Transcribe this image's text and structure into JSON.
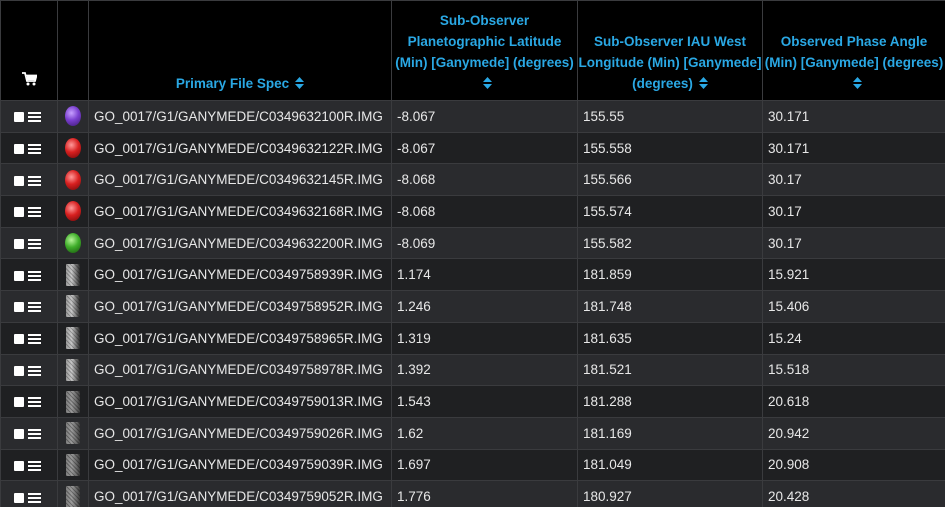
{
  "header": {
    "spec": "Primary File Spec",
    "lat": "Sub-Observer Planetographic Latitude (Min) [Ganymede] (degrees)",
    "lon": "Sub-Observer IAU West Longitude (Min) [Ganymede] (degrees)",
    "phase": "Observed Phase Angle (Min) [Ganymede] (degrees)"
  },
  "icons": {
    "cart": "shopping-cart-icon",
    "sort": "sort-updown-icon",
    "menu": "hamburger-menu-icon",
    "checkbox": "checkbox"
  },
  "colors": {
    "header_text": "#2aa8e4",
    "header_bg": "#000000",
    "row_odd": "#2a2b2e",
    "row_even": "#1f2022",
    "text": "#e8e8e8"
  },
  "rows": [
    {
      "thumb": "violet-filter-thumbnail",
      "spec": "GO_0017/G1/GANYMEDE/C0349632100R.IMG",
      "lat": "-8.067",
      "lon": "155.55",
      "phase": "30.171"
    },
    {
      "thumb": "red-filter-thumbnail",
      "spec": "GO_0017/G1/GANYMEDE/C0349632122R.IMG",
      "lat": "-8.067",
      "lon": "155.558",
      "phase": "30.171"
    },
    {
      "thumb": "red-filter-thumbnail",
      "spec": "GO_0017/G1/GANYMEDE/C0349632145R.IMG",
      "lat": "-8.068",
      "lon": "155.566",
      "phase": "30.17"
    },
    {
      "thumb": "red-filter-thumbnail",
      "spec": "GO_0017/G1/GANYMEDE/C0349632168R.IMG",
      "lat": "-8.068",
      "lon": "155.574",
      "phase": "30.17"
    },
    {
      "thumb": "green-filter-thumbnail",
      "spec": "GO_0017/G1/GANYMEDE/C0349632200R.IMG",
      "lat": "-8.069",
      "lon": "155.582",
      "phase": "30.17"
    },
    {
      "thumb": "grayscale-image-thumbnail",
      "spec": "GO_0017/G1/GANYMEDE/C0349758939R.IMG",
      "lat": "1.174",
      "lon": "181.859",
      "phase": "15.921"
    },
    {
      "thumb": "grayscale-image-thumbnail",
      "spec": "GO_0017/G1/GANYMEDE/C0349758952R.IMG",
      "lat": "1.246",
      "lon": "181.748",
      "phase": "15.406"
    },
    {
      "thumb": "grayscale-image-thumbnail",
      "spec": "GO_0017/G1/GANYMEDE/C0349758965R.IMG",
      "lat": "1.319",
      "lon": "181.635",
      "phase": "15.24"
    },
    {
      "thumb": "grayscale-image-thumbnail",
      "spec": "GO_0017/G1/GANYMEDE/C0349758978R.IMG",
      "lat": "1.392",
      "lon": "181.521",
      "phase": "15.518"
    },
    {
      "thumb": "grayscale-image-thumbnail",
      "spec": "GO_0017/G1/GANYMEDE/C0349759013R.IMG",
      "lat": "1.543",
      "lon": "181.288",
      "phase": "20.618"
    },
    {
      "thumb": "grayscale-image-thumbnail",
      "spec": "GO_0017/G1/GANYMEDE/C0349759026R.IMG",
      "lat": "1.62",
      "lon": "181.169",
      "phase": "20.942"
    },
    {
      "thumb": "grayscale-image-thumbnail",
      "spec": "GO_0017/G1/GANYMEDE/C0349759039R.IMG",
      "lat": "1.697",
      "lon": "181.049",
      "phase": "20.908"
    },
    {
      "thumb": "grayscale-image-thumbnail",
      "spec": "GO_0017/G1/GANYMEDE/C0349759052R.IMG",
      "lat": "1.776",
      "lon": "180.927",
      "phase": "20.428"
    }
  ]
}
